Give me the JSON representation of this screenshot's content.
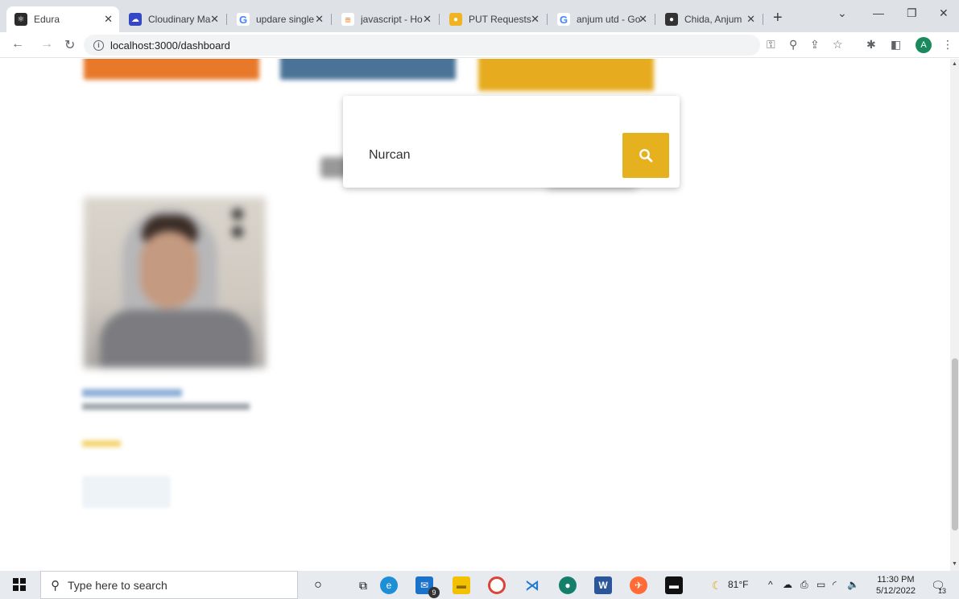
{
  "browser": {
    "tabs": [
      {
        "title": "Edura",
        "active": true,
        "favicon_color": "#2b2b2b"
      },
      {
        "title": "Cloudinary Ma",
        "active": false,
        "favicon_color": "#3448c5"
      },
      {
        "title": "updare single",
        "active": false,
        "favicon_color": "#4285f4"
      },
      {
        "title": "javascript - Ho",
        "active": false,
        "favicon_color": "#f48024"
      },
      {
        "title": "PUT Requests",
        "active": false,
        "favicon_color": "#f0b323"
      },
      {
        "title": "anjum utd - Go",
        "active": false,
        "favicon_color": "#4285f4"
      },
      {
        "title": "Chida, Anjum",
        "active": false,
        "favicon_color": "#333333"
      }
    ],
    "address": "localhost:3000/dashboard",
    "profile_initial": "A"
  },
  "page": {
    "tiles": [
      {
        "color": "#e8792a"
      },
      {
        "color": "#4b7397"
      },
      {
        "color": "#e6ab1e"
      }
    ],
    "search": {
      "value": "Nurcan",
      "button_color": "#e6b11f"
    }
  },
  "taskbar": {
    "search_placeholder": "Type here to search",
    "mail_badge": "9",
    "notifications_badge": "13",
    "weather": "81°F",
    "time": "11:30 PM",
    "date": "5/12/2022"
  }
}
